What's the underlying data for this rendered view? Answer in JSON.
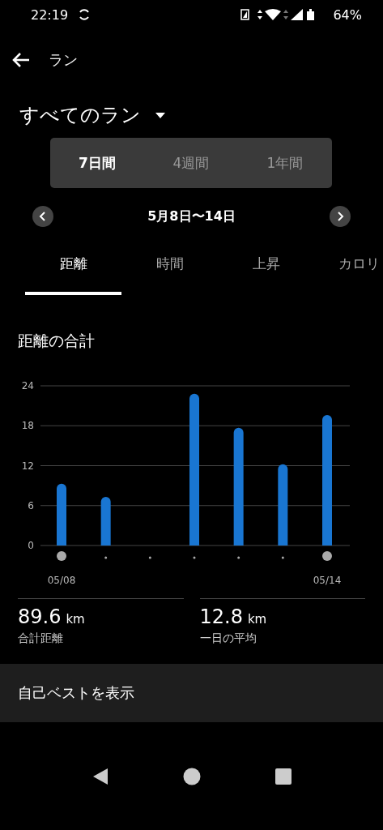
{
  "status_bar": {
    "time": "22:19",
    "battery": "64%"
  },
  "header": {
    "title": "ラン"
  },
  "filter": {
    "label": "すべてのラン"
  },
  "periods": [
    {
      "label": "7日間",
      "selected": true
    },
    {
      "label": "4週間",
      "selected": false
    },
    {
      "label": "1年間",
      "selected": false
    }
  ],
  "date_range": "5月8日〜14日",
  "tabs": [
    {
      "label": "距離",
      "selected": true
    },
    {
      "label": "時間",
      "selected": false
    },
    {
      "label": "上昇",
      "selected": false
    },
    {
      "label": "カロリ",
      "selected": false
    }
  ],
  "section_title": "距離の合計",
  "chart": {
    "chart_data": {
      "type": "bar",
      "categories": [
        "05/08",
        null,
        null,
        null,
        null,
        null,
        "05/14"
      ],
      "ylim": [
        0,
        24
      ],
      "grid": true,
      "yticks": [
        0,
        6,
        12,
        18,
        24
      ],
      "series": [
        {
          "color": "#1976d2",
          "values": [
            9.3,
            7.3,
            null,
            22.8,
            17.7,
            12.2,
            19.6
          ]
        }
      ]
    }
  },
  "stats": [
    {
      "value": "89.6",
      "unit": "km",
      "label": "合計距離"
    },
    {
      "value": "12.8",
      "unit": "km",
      "label": "一日の平均"
    }
  ],
  "best_link": "自己ベストを表示"
}
